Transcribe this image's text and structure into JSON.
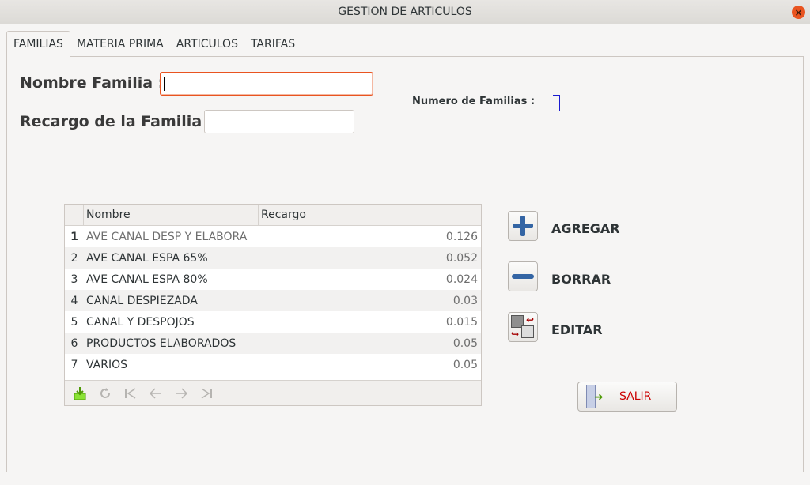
{
  "window": {
    "title": "GESTION DE ARTICULOS"
  },
  "tabs": [
    {
      "label": "FAMILIAS",
      "active": true
    },
    {
      "label": "MATERIA PRIMA",
      "active": false
    },
    {
      "label": "ARTICULOS",
      "active": false
    },
    {
      "label": "TARIFAS",
      "active": false
    }
  ],
  "form": {
    "nombre_label": "Nombre Familia :",
    "nombre_value": "",
    "recargo_label": "Recargo de la Familia :",
    "recargo_value": "",
    "count_label": "Numero de Familias :",
    "count_value": ""
  },
  "grid": {
    "columns": [
      "Nombre",
      "Recargo"
    ],
    "rows": [
      {
        "num": "1",
        "nombre": "AVE CANAL DESP Y ELABORA",
        "recargo": "0.126"
      },
      {
        "num": "2",
        "nombre": "AVE CANAL ESPA 65%",
        "recargo": "0.052"
      },
      {
        "num": "3",
        "nombre": "AVE CANAL ESPA 80%",
        "recargo": "0.024"
      },
      {
        "num": "4",
        "nombre": "CANAL DESPIEZADA",
        "recargo": "0.03"
      },
      {
        "num": "5",
        "nombre": "CANAL Y DESPOJOS",
        "recargo": "0.015"
      },
      {
        "num": "6",
        "nombre": "PRODUCTOS ELABORADOS",
        "recargo": "0.05"
      },
      {
        "num": "7",
        "nombre": "VARIOS",
        "recargo": "0.05"
      }
    ],
    "nav_icons": [
      "insert-row-icon",
      "refresh-icon",
      "first-record-icon",
      "previous-record-icon",
      "next-record-icon",
      "last-record-icon"
    ]
  },
  "actions": {
    "agregar": "AGREGAR",
    "borrar": "BORRAR",
    "editar": "EDITAR",
    "salir": "SALIR"
  },
  "colors": {
    "accent": "#e95420",
    "icon_blue": "#3465a4",
    "salir_text": "#cc0000"
  }
}
